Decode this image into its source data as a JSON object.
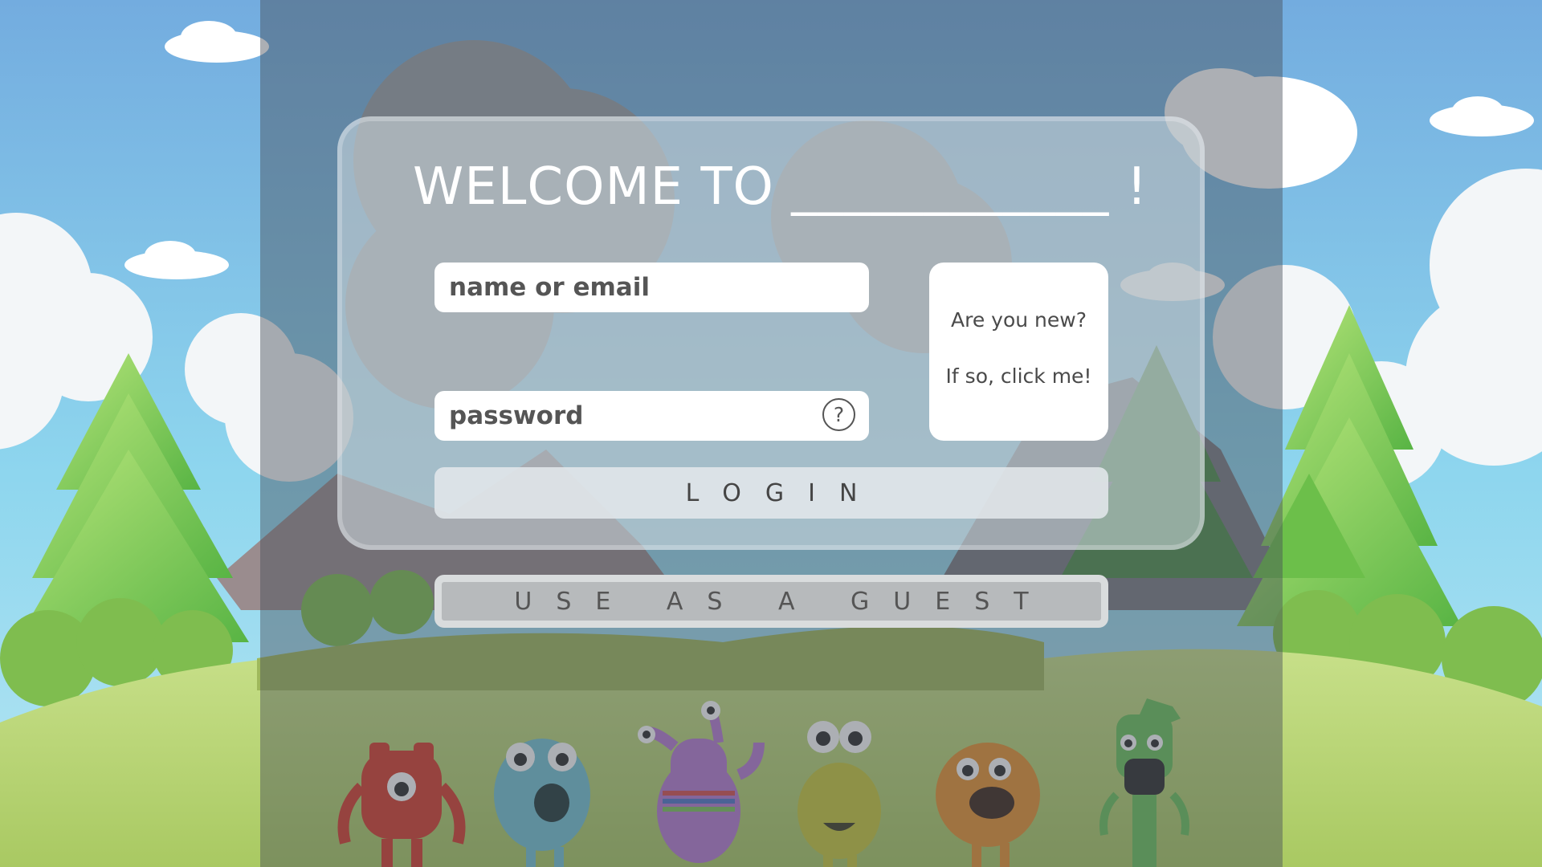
{
  "title": "WELCOME TO ____________ !",
  "form": {
    "username_placeholder": "name or email",
    "password_placeholder": "password",
    "help_glyph": "?",
    "login_label": "LOGIN",
    "guest_label": "USE AS A GUEST"
  },
  "signup": {
    "line1": "Are you new?",
    "line2": "If so, click me!"
  },
  "icons": {
    "help": "question-mark-circle-icon"
  },
  "colors": {
    "sky_top": "#78b4e2",
    "sky_bottom": "#8fd8ee",
    "hill": "#b9d67a",
    "overlay": "#464e58",
    "card": "#d2dce2",
    "button_text": "#454545"
  }
}
